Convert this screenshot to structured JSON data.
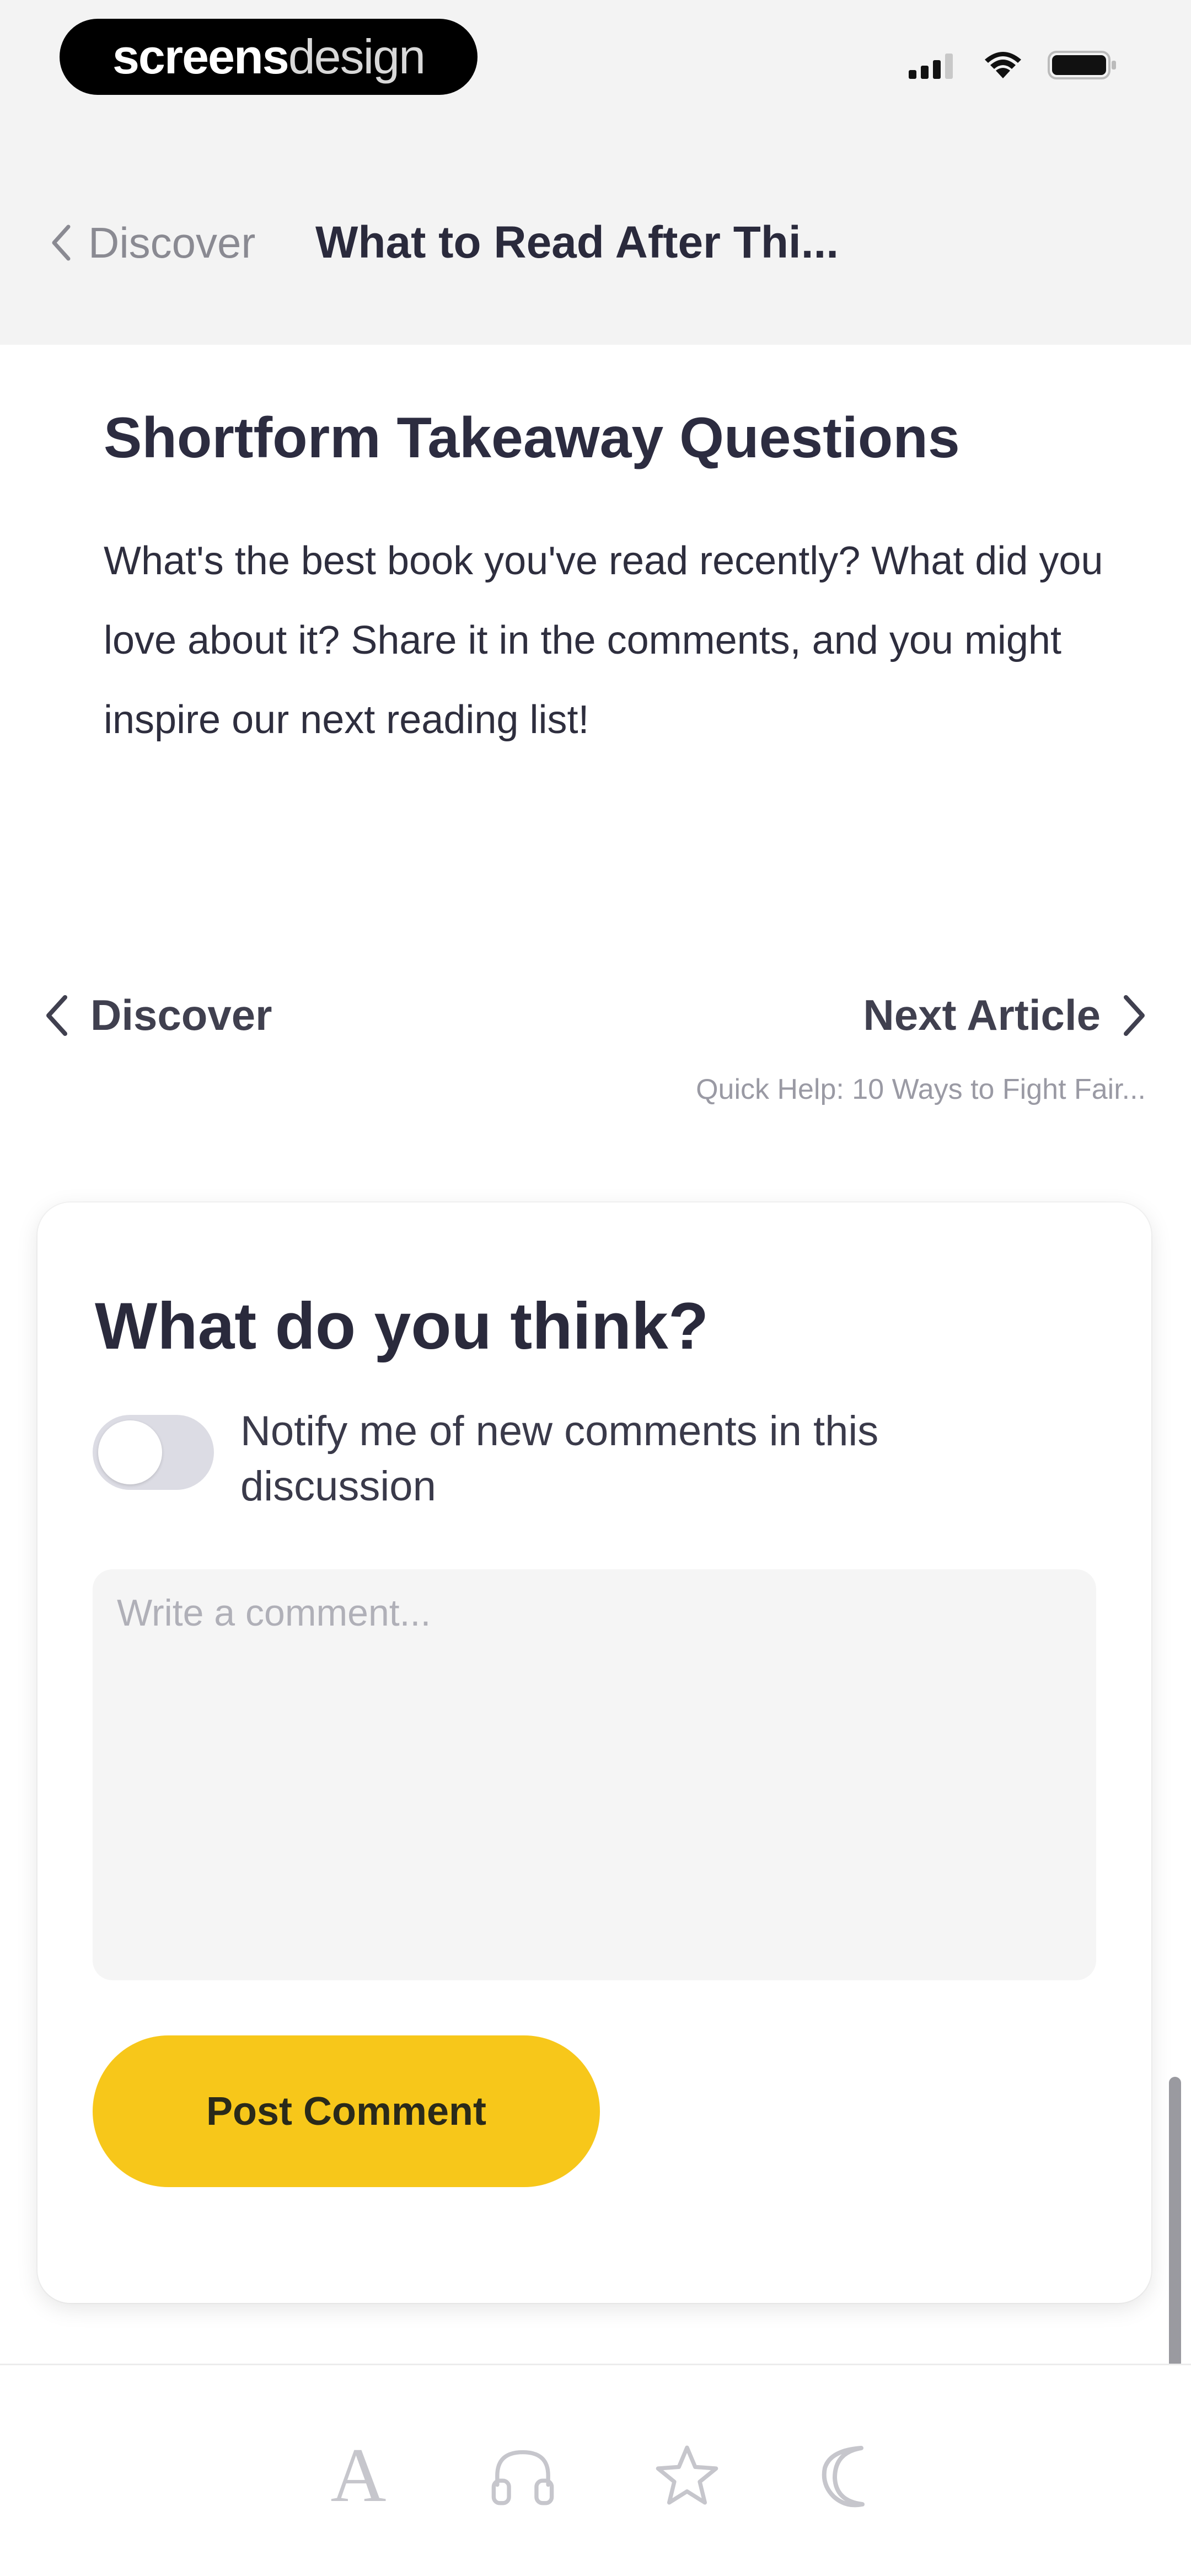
{
  "status_bar": {
    "brand_bold": "screens",
    "brand_light": "design",
    "icons": [
      "signal-icon",
      "wifi-icon",
      "battery-icon"
    ]
  },
  "header": {
    "back_label": "Discover",
    "title": "What to Read After Thi..."
  },
  "article": {
    "section_title": "Shortform Takeaway Questions",
    "section_body": "What's the best book you've read recently? What did you love about it? Share it in the comments, and you might inspire our next reading list!"
  },
  "article_nav": {
    "prev_label": "Discover",
    "next_label": "Next Article",
    "next_subtitle": "Quick Help: 10 Ways to Fight Fair..."
  },
  "comment": {
    "heading": "What do you think?",
    "notify_label": "Notify me of new comments in this discussion",
    "notify_enabled": false,
    "placeholder": "Write a comment...",
    "value": "",
    "post_label": "Post Comment"
  },
  "toolbar": {
    "icons": [
      "font-icon",
      "headphones-icon",
      "star-icon",
      "moon-icon"
    ]
  },
  "colors": {
    "accent": "#f7c71a",
    "text_primary": "#2a2a3c",
    "text_muted": "#9a9aa4",
    "header_bg": "#f3f3f3"
  }
}
